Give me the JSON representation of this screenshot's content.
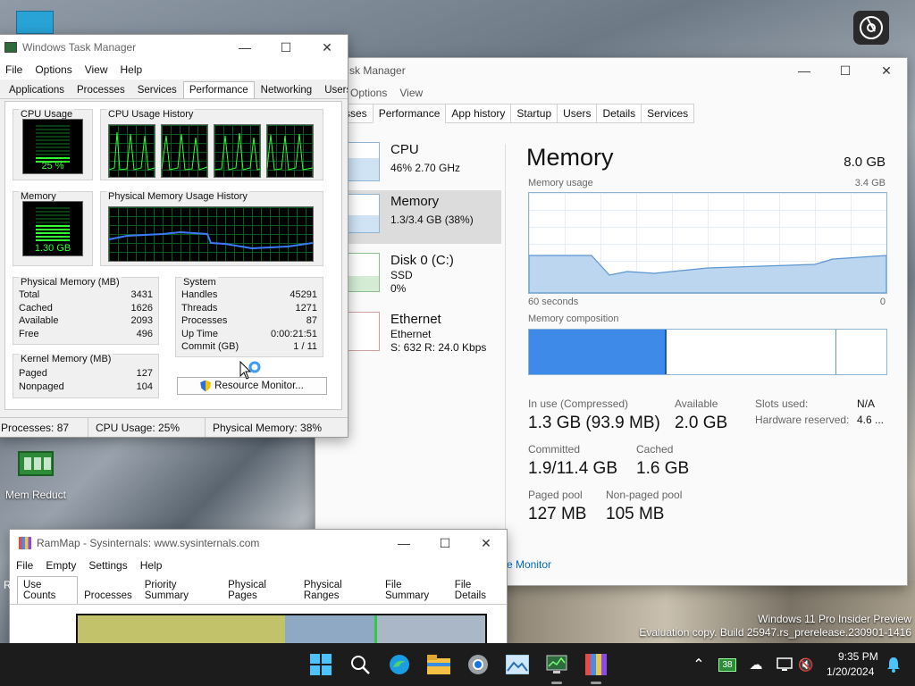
{
  "desktop": {
    "mem_reduct_label": "Mem Reduct",
    "watermark_line1": "Windows 11 Pro Insider Preview",
    "watermark_line2": "Evaluation copy. Build 25947.rs_prerelease.230901-1416",
    "user_label": "(...)"
  },
  "legacy_tm": {
    "title": "Windows Task Manager",
    "menu": [
      "File",
      "Options",
      "View",
      "Help"
    ],
    "tabs": [
      "Applications",
      "Processes",
      "Services",
      "Performance",
      "Networking",
      "Users"
    ],
    "active_tab": "Performance",
    "cpu_usage_title": "CPU Usage",
    "cpu_usage_value": "25 %",
    "cpu_history_title": "CPU Usage History",
    "memory_title": "Memory",
    "memory_value": "1.30 GB",
    "phys_history_title": "Physical Memory Usage History",
    "physical_memory": {
      "title": "Physical Memory (MB)",
      "rows": [
        {
          "k": "Total",
          "v": "3431"
        },
        {
          "k": "Cached",
          "v": "1626"
        },
        {
          "k": "Available",
          "v": "2093"
        },
        {
          "k": "Free",
          "v": "496"
        }
      ]
    },
    "system": {
      "title": "System",
      "rows": [
        {
          "k": "Handles",
          "v": "45291"
        },
        {
          "k": "Threads",
          "v": "1271"
        },
        {
          "k": "Processes",
          "v": "87"
        },
        {
          "k": "Up Time",
          "v": "0:00:21:51"
        },
        {
          "k": "Commit (GB)",
          "v": "1 / 11"
        }
      ]
    },
    "kernel_memory": {
      "title": "Kernel Memory (MB)",
      "rows": [
        {
          "k": "Paged",
          "v": "127"
        },
        {
          "k": "Nonpaged",
          "v": "104"
        }
      ]
    },
    "resource_monitor_button": "Resource Monitor...",
    "status": {
      "processes": "Processes: 87",
      "cpu": "CPU Usage: 25%",
      "memory": "Physical Memory: 38%"
    }
  },
  "modern_tm": {
    "title": "sk Manager",
    "menu": [
      "Options",
      "View"
    ],
    "tabs": [
      "sses",
      "Performance",
      "App history",
      "Startup",
      "Users",
      "Details",
      "Services"
    ],
    "active_tab": "Performance",
    "sidebar": [
      {
        "name": "CPU",
        "sub1": "46%  2.70 GHz",
        "sub2": "",
        "sub3": ""
      },
      {
        "name": "Memory",
        "sub1": "1.3/3.4 GB (38%)",
        "sub2": "",
        "sub3": ""
      },
      {
        "name": "Disk 0 (C:)",
        "sub1": "SSD",
        "sub2": "0%",
        "sub3": ""
      },
      {
        "name": "Ethernet",
        "sub1": "Ethernet",
        "sub2": "S: 632  R: 24.0 Kbps",
        "sub3": ""
      }
    ],
    "memory_heading": "Memory",
    "memory_total": "8.0 GB",
    "usage_label": "Memory usage",
    "usage_max": "3.4 GB",
    "axis_left": "60 seconds",
    "axis_right": "0",
    "composition_label": "Memory composition",
    "stats": {
      "in_use_label": "In use (Compressed)",
      "in_use_value": "1.3 GB (93.9 MB)",
      "available_label": "Available",
      "available_value": "2.0 GB",
      "committed_label": "Committed",
      "committed_value": "1.9/11.4 GB",
      "cached_label": "Cached",
      "cached_value": "1.6 GB",
      "paged_label": "Paged pool",
      "paged_value": "127 MB",
      "nonpaged_label": "Non-paged pool",
      "nonpaged_value": "105 MB",
      "slots_label": "Slots used:",
      "slots_value": "N/A",
      "hw_label": "Hardware reserved:",
      "hw_value": "4.6 ..."
    },
    "open_rm_link": "e Monitor"
  },
  "rammap": {
    "title": "RamMap - Sysinternals: www.sysinternals.com",
    "menu": [
      "File",
      "Empty",
      "Settings",
      "Help"
    ],
    "tabs": [
      "Use Counts",
      "Processes",
      "Priority Summary",
      "Physical Pages",
      "Physical Ranges",
      "File Summary",
      "File Details"
    ],
    "active_tab": "Use Counts",
    "left_edge_text": "R"
  },
  "taskbar": {
    "time": "9:35 PM",
    "date": "1/20/2024",
    "tray_badge": "38"
  },
  "colors": {
    "graph_green": "#33ff33",
    "mem_blue": "#3d8ae8",
    "accent": "#0067c0"
  }
}
